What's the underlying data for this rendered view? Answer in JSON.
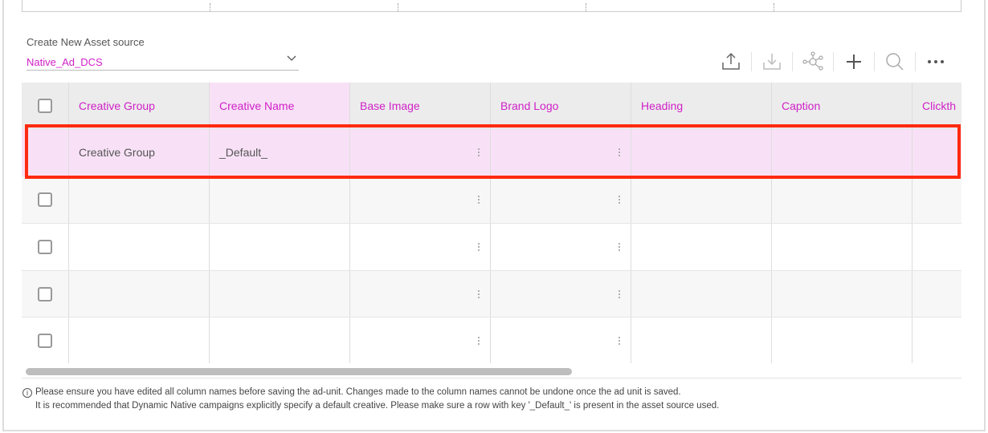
{
  "asset_source": {
    "label": "Create New Asset source",
    "selected": "Native_Ad_DCS"
  },
  "toolbar": {
    "icons": [
      "upload-icon",
      "download-icon",
      "network-icon",
      "plus-icon",
      "search-icon",
      "more-icon"
    ]
  },
  "table": {
    "columns": [
      "Creative Group",
      "Creative Name",
      "Base Image",
      "Brand Logo",
      "Heading",
      "Caption",
      "Clickth"
    ],
    "rows": [
      {
        "creative_group": "Creative Group",
        "creative_name": "_Default_"
      },
      {
        "creative_group": "",
        "creative_name": ""
      },
      {
        "creative_group": "",
        "creative_name": ""
      },
      {
        "creative_group": "",
        "creative_name": ""
      },
      {
        "creative_group": "",
        "creative_name": ""
      }
    ]
  },
  "notes": {
    "line1": "Please ensure you have edited all column names before saving the ad-unit. Changes made to the column names cannot be undone once the ad unit is saved.",
    "line2": "It is recommended that Dynamic Native campaigns explicitly specify a default creative. Please make sure a row with key '_Default_' is present in the asset source used.",
    "info_icon": "i"
  },
  "colors": {
    "accent": "#d020c8",
    "highlight": "#ff2a10",
    "pink_row": "#f8e1f6"
  }
}
